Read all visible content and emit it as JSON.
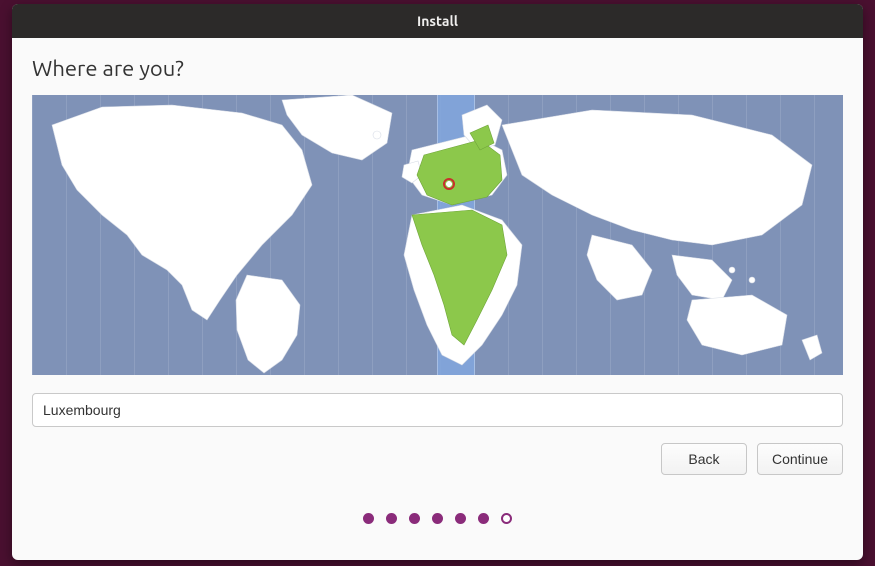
{
  "window": {
    "title": "Install"
  },
  "heading": "Where are you?",
  "location": {
    "value": "Luxembourg",
    "placeholder": ""
  },
  "buttons": {
    "back": "Back",
    "continue": "Continue"
  },
  "progress": {
    "total": 7,
    "current": 6
  },
  "accent_color": "#8a2b7a",
  "map": {
    "selected_timezone_band": "+1",
    "highlight_color": "#82c341",
    "highlighted_regions": [
      "Central/Western Europe",
      "North & West-Central Africa"
    ]
  }
}
